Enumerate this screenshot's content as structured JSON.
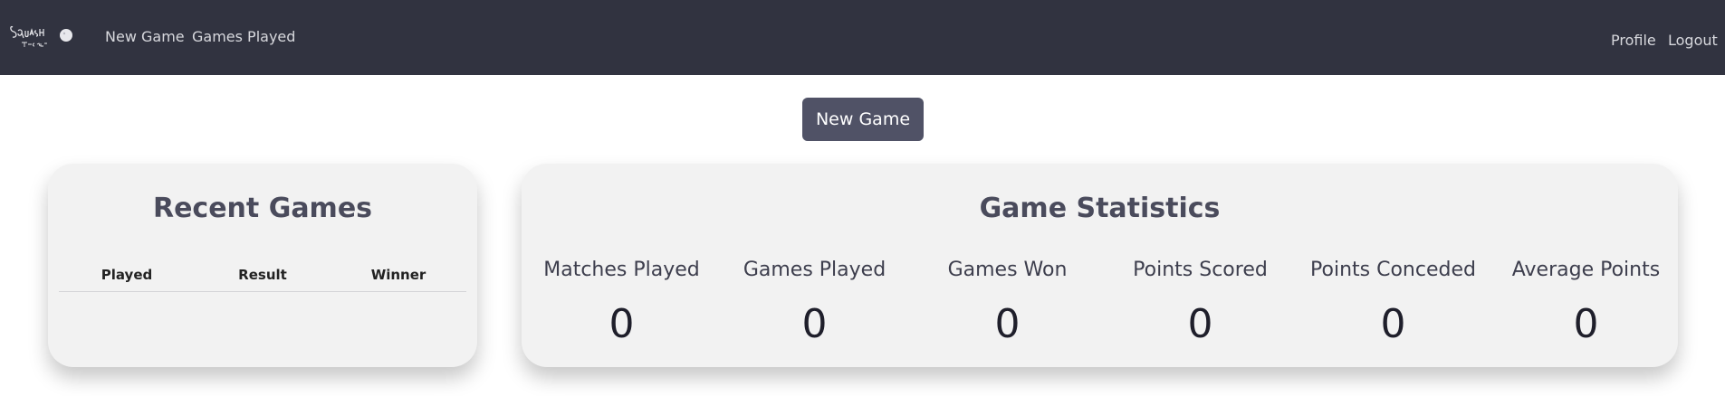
{
  "nav": {
    "logo_alt": "Squash Tracker",
    "links": [
      {
        "label": "New Game"
      },
      {
        "label": "Games Played"
      }
    ],
    "right_links": [
      {
        "label": "Profile"
      },
      {
        "label": "Logout"
      }
    ]
  },
  "actions": {
    "new_game_label": "New Game"
  },
  "recent_games": {
    "title": "Recent Games",
    "columns": [
      "Played",
      "Result",
      "Winner"
    ],
    "rows": []
  },
  "statistics": {
    "title": "Game Statistics",
    "items": [
      {
        "label": "Matches Played",
        "value": "0"
      },
      {
        "label": "Games Played",
        "value": "0"
      },
      {
        "label": "Games Won",
        "value": "0"
      },
      {
        "label": "Points Scored",
        "value": "0"
      },
      {
        "label": "Points Conceded",
        "value": "0"
      },
      {
        "label": "Average Points",
        "value": "0"
      }
    ]
  },
  "colors": {
    "navbar_bg": "#313340",
    "button_bg": "#505266",
    "card_bg": "#f2f2f2"
  }
}
